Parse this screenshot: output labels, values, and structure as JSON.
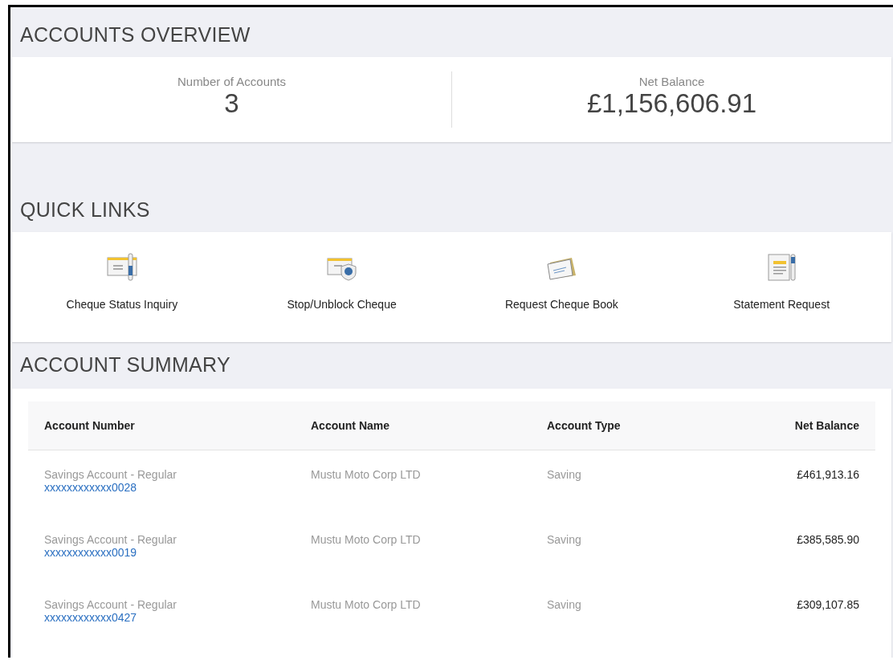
{
  "overview": {
    "title": "ACCOUNTS OVERVIEW",
    "stats": [
      {
        "label": "Number of Accounts",
        "value": "3"
      },
      {
        "label": "Net Balance",
        "value": "£1,156,606.91"
      }
    ]
  },
  "quick_links": {
    "title": "QUICK LINKS",
    "items": [
      {
        "kind": "cheque-pen",
        "label": "Cheque Status Inquiry"
      },
      {
        "kind": "cheque-shield",
        "label": "Stop/Unblock Cheque"
      },
      {
        "kind": "envelope",
        "label": "Request Cheque Book"
      },
      {
        "kind": "document",
        "label": "Statement Request"
      }
    ]
  },
  "summary": {
    "title": "ACCOUNT SUMMARY",
    "columns": [
      "Account Number",
      "Account Name",
      "Account Type",
      "Net Balance"
    ],
    "rows": [
      {
        "product": "Savings Account - Regular",
        "number": "xxxxxxxxxxxx0028",
        "name": "Mustu Moto Corp LTD",
        "type": "Saving",
        "balance": "£461,913.16"
      },
      {
        "product": "Savings Account - Regular",
        "number": "xxxxxxxxxxxx0019",
        "name": "Mustu Moto Corp LTD",
        "type": "Saving",
        "balance": "£385,585.90"
      },
      {
        "product": "Savings Account - Regular",
        "number": "xxxxxxxxxxxx0427",
        "name": "Mustu Moto Corp LTD",
        "type": "Saving",
        "balance": "£309,107.85"
      }
    ]
  }
}
